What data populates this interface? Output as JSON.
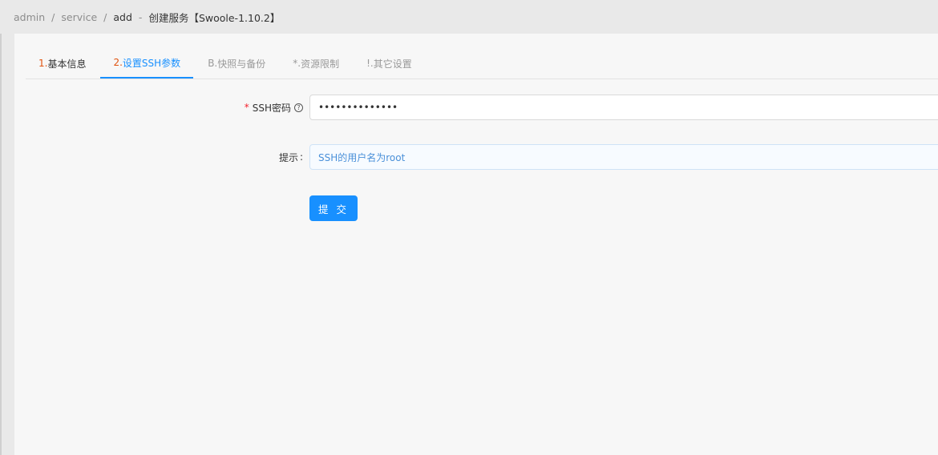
{
  "breadcrumb": {
    "items": [
      "admin",
      "service",
      "add"
    ],
    "separator": "/",
    "dash": "-",
    "title": "创建服务【Swoole-1.10.2】"
  },
  "tabs": [
    {
      "num": "1.",
      "label": "基本信息",
      "state": "done"
    },
    {
      "num": "2.",
      "label": "设置SSH参数",
      "state": "active"
    },
    {
      "num": "B.",
      "label": "快照与备份",
      "state": "pending"
    },
    {
      "num": "*.",
      "label": "资源限制",
      "state": "pending"
    },
    {
      "num": "!.",
      "label": "其它设置",
      "state": "pending"
    }
  ],
  "form": {
    "password": {
      "required_mark": "*",
      "label": "SSH密码",
      "help_icon": "question-circle-icon",
      "value": "••••••••••••••"
    },
    "hint": {
      "label": "提示",
      "colon": ":",
      "value": "SSH的用户名为root"
    },
    "submit_label": "提 交"
  },
  "colors": {
    "accent": "#1890ff",
    "step_number": "#e0530f",
    "required": "#f5222d"
  }
}
